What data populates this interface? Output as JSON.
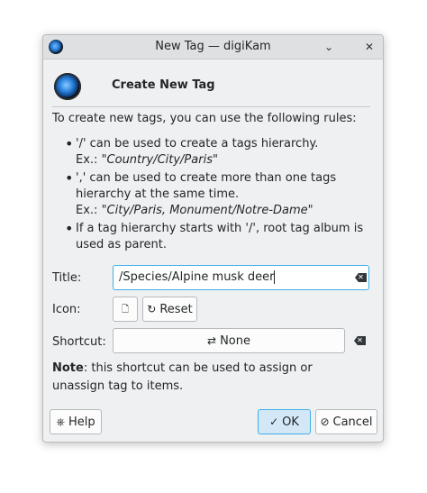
{
  "window": {
    "title": "New Tag — digiKam"
  },
  "titlebar": {
    "icons": [
      "digikam-icon",
      "chevron-down-icon",
      "close-icon"
    ]
  },
  "header": {
    "title": "Create New Tag"
  },
  "intro": "To create new tags, you can use the following rules:",
  "rules": [
    {
      "text": "'/' can be used to create a tags hierarchy.",
      "ex_label": "Ex.: ",
      "ex_value": "\"Country/City/Paris\""
    },
    {
      "text": "',' can be used to create more than one tags hierarchy at the same time.",
      "ex_label": "Ex.: ",
      "ex_value": "\"City/Paris, Monument/Notre-Dame\""
    },
    {
      "text": "If a tag hierarchy starts with '/', root tag album is used as parent."
    }
  ],
  "form": {
    "title_label": "Title:",
    "title_value": "/Species/Alpine musk deer",
    "icon_label": "Icon:",
    "reset_label": "Reset",
    "shortcut_label": "Shortcut:",
    "shortcut_value": "None"
  },
  "note": {
    "bold": "Note",
    "text": ": this shortcut can be used to assign or unassign tag to items."
  },
  "buttons": {
    "help": "Help",
    "ok": "OK",
    "cancel": "Cancel"
  },
  "colors": {
    "accent": "#3daee9",
    "window_bg": "#eff0f1"
  }
}
